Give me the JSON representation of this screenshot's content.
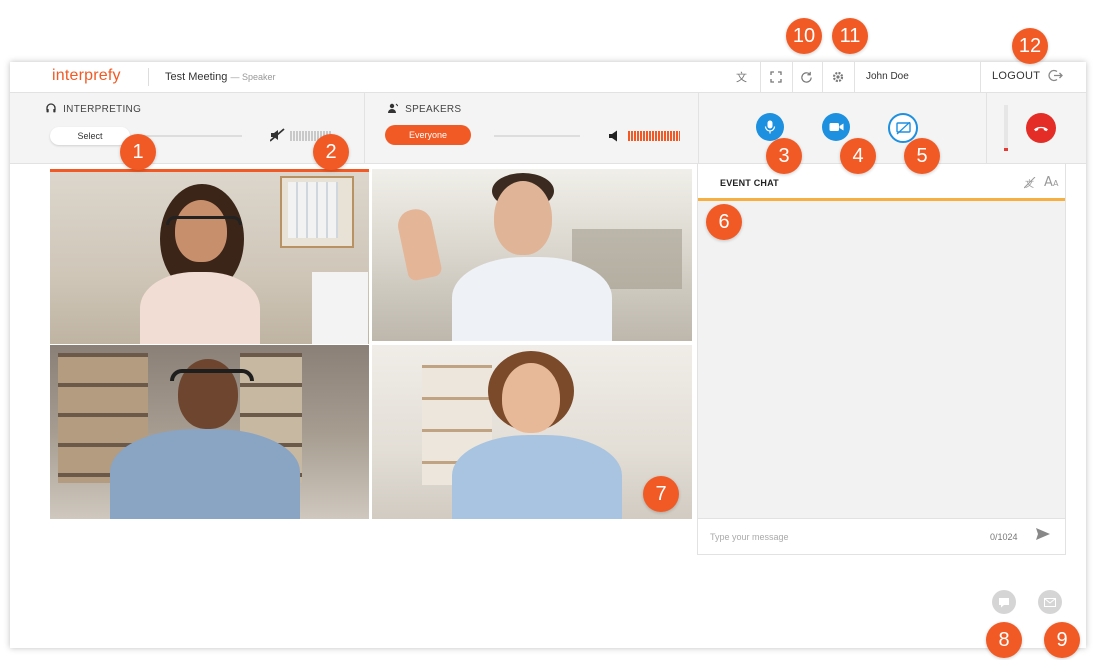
{
  "topbar": {
    "logo": "interprefy",
    "meeting_title": "Test Meeting",
    "meeting_role": "— Speaker",
    "user_name": "John Doe",
    "logout_label": "LOGOUT"
  },
  "interpreting": {
    "title": "INTERPRETING",
    "select_label": "Select"
  },
  "speakers": {
    "title": "SPEAKERS",
    "selected": "Everyone"
  },
  "chat": {
    "title": "EVENT CHAT",
    "placeholder": "Type your message",
    "counter": "0/1024"
  },
  "video_tiles": [
    {
      "participant": "participant-1"
    },
    {
      "participant": "participant-2"
    },
    {
      "participant": "participant-3"
    },
    {
      "participant": "participant-4"
    }
  ],
  "badges": [
    "1",
    "2",
    "3",
    "4",
    "5",
    "6",
    "7",
    "8",
    "9",
    "10",
    "11",
    "12"
  ],
  "colors": {
    "brand": "#f15a24",
    "mic_button": "#1e90e0",
    "hangup": "#e52d27",
    "chat_accent": "#f5b041"
  },
  "icons": {
    "translate": "translate-icon",
    "fullscreen": "fullscreen-icon",
    "refresh": "refresh-icon",
    "settings": "gear-icon",
    "logout": "logout-icon",
    "headphones": "headphones-icon",
    "mic": "microphone-icon",
    "camera": "camera-icon",
    "share": "screen-share-icon",
    "hangup": "phone-hangup-icon"
  }
}
